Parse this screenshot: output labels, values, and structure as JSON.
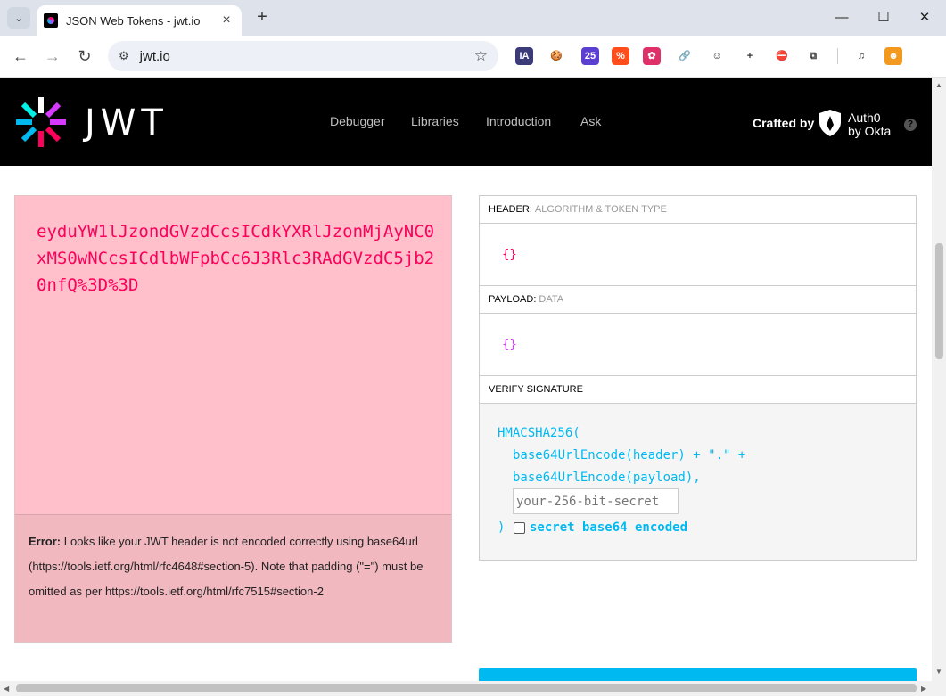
{
  "browser": {
    "tab_title": "JSON Web Tokens - jwt.io",
    "url": "jwt.io",
    "extensions": [
      {
        "name": "ia-extension-icon",
        "label": "IA",
        "color": "#3b3b7a"
      },
      {
        "name": "cookie-extension-icon",
        "label": "🍪",
        "color": "#ffffff"
      },
      {
        "name": "badge-extension-icon",
        "label": "25",
        "color": "#5b3fd0"
      },
      {
        "name": "percent-extension-icon",
        "label": "%",
        "color": "#ff4d1c"
      },
      {
        "name": "puzzle-color-extension-icon",
        "label": "✿",
        "color": "#e0306a"
      },
      {
        "name": "link-extension-icon",
        "label": "🔗",
        "color": "#ffffff"
      },
      {
        "name": "face-extension-icon",
        "label": "☺",
        "color": "#ffffff"
      },
      {
        "name": "plus-extension-icon",
        "label": "+",
        "color": "#ffffff"
      },
      {
        "name": "blocker-extension-icon",
        "label": "⛔",
        "color": "#ffffff"
      },
      {
        "name": "extensions-puzzle-icon",
        "label": "⧉",
        "color": "#ffffff"
      },
      {
        "name": "media-queue-icon",
        "label": "♫",
        "color": "#ffffff"
      },
      {
        "name": "profile-avatar-icon",
        "label": "☻",
        "color": "#f39a1e"
      }
    ]
  },
  "header": {
    "logo_text": "JWT",
    "menu": [
      "Debugger",
      "Libraries",
      "Introduction",
      "Ask"
    ],
    "crafted_by": "Crafted by",
    "auth0_line1": "Auth0",
    "auth0_line2": "by Okta",
    "help": "?"
  },
  "encoded": {
    "token": "eyduYW1lJzondGVzdCcsICdkYXRlJzonMjAyNC0xMS0wNCcsICdlbWFpbCc6J3Rlc3RAdGVzdC5jb20nfQ%3D%3D",
    "error_label": "Error:",
    "error_text": " Looks like your JWT header is not encoded correctly using base64url (https://tools.ietf.org/html/rfc4648#section-5). Note that padding (\"=\") must be omitted as per https://tools.ietf.org/html/rfc7515#section-2"
  },
  "decoded": {
    "header_label": "HEADER:",
    "header_sub": "ALGORITHM & TOKEN TYPE",
    "header_value": "{}",
    "payload_label": "PAYLOAD:",
    "payload_sub": "DATA",
    "payload_value": "{}",
    "verify_label": "VERIFY SIGNATURE",
    "code_line1": "HMACSHA256(",
    "code_line2": "base64UrlEncode(header) + \".\" +",
    "code_line3": "base64UrlEncode(payload),",
    "secret_placeholder": "your-256-bit-secret",
    "code_close": ")",
    "secret_checkbox_label": "secret base64 encoded"
  },
  "colors": {
    "token": "#fb015b",
    "header_json": "#fb015b",
    "payload_json": "#d63aff",
    "signature": "#00b9f1"
  }
}
